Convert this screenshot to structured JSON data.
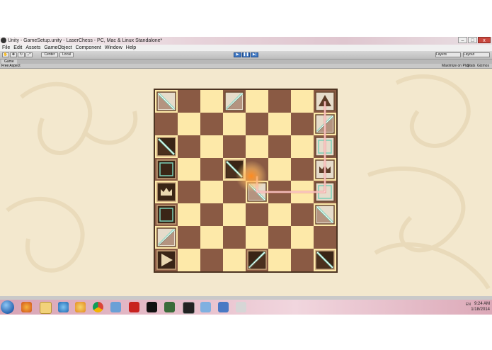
{
  "window": {
    "title": "Unity - GameSetup.unity - LaserChess - PC, Mac & Linux Standalone*",
    "controls": [
      "–",
      "□",
      "x"
    ]
  },
  "menu": [
    "File",
    "Edit",
    "Assets",
    "GameObject",
    "Component",
    "Window",
    "Help"
  ],
  "toolbar": {
    "pivot_label": "Center",
    "space_label": "Local",
    "layers_label": "Layers",
    "layout_label": "Layout"
  },
  "game_panel": {
    "tab_label": "Game",
    "aspect_label": "Free Aspect",
    "maximize_label": "Maximize on Play",
    "stats_label": "Stats",
    "gizmos_label": "Gizmos"
  },
  "board": {
    "size": 8,
    "colors": {
      "light": "#fde9a9",
      "dark": "#8a5a44",
      "piece_light": "#e6dccb",
      "piece_dark": "#3a2516",
      "laser": "#f08a8a",
      "laser_core": "#fff4f0",
      "mirror": "#7ad0b8"
    },
    "pieces": [
      {
        "row": 0,
        "col": 0,
        "kind": "mirror",
        "side": "light",
        "orient": "nw"
      },
      {
        "row": 0,
        "col": 3,
        "kind": "mirror",
        "side": "light",
        "orient": "ne"
      },
      {
        "row": 0,
        "col": 7,
        "kind": "laser",
        "side": "light",
        "orient": "up"
      },
      {
        "row": 1,
        "col": 7,
        "kind": "mirror",
        "side": "light",
        "orient": "ne"
      },
      {
        "row": 2,
        "col": 0,
        "kind": "mirror",
        "side": "dark",
        "orient": "nw"
      },
      {
        "row": 2,
        "col": 7,
        "kind": "block",
        "side": "light"
      },
      {
        "row": 3,
        "col": 0,
        "kind": "block",
        "side": "dark"
      },
      {
        "row": 3,
        "col": 3,
        "kind": "mirror",
        "side": "dark",
        "orient": "nw"
      },
      {
        "row": 3,
        "col": 7,
        "kind": "king",
        "side": "light"
      },
      {
        "row": 4,
        "col": 0,
        "kind": "king",
        "side": "dark"
      },
      {
        "row": 4,
        "col": 4,
        "kind": "mirror",
        "side": "light",
        "orient": "nw"
      },
      {
        "row": 4,
        "col": 7,
        "kind": "block",
        "side": "light"
      },
      {
        "row": 5,
        "col": 0,
        "kind": "block",
        "side": "dark"
      },
      {
        "row": 5,
        "col": 7,
        "kind": "mirror",
        "side": "light",
        "orient": "nw"
      },
      {
        "row": 6,
        "col": 0,
        "kind": "mirror",
        "side": "light",
        "orient": "ne"
      },
      {
        "row": 7,
        "col": 0,
        "kind": "laser",
        "side": "dark",
        "orient": "right"
      },
      {
        "row": 7,
        "col": 4,
        "kind": "mirror",
        "side": "dark",
        "orient": "ne"
      },
      {
        "row": 7,
        "col": 7,
        "kind": "mirror",
        "side": "dark",
        "orient": "nw"
      }
    ],
    "laser_path": [
      [
        0,
        7
      ],
      [
        4,
        7
      ],
      [
        4,
        4
      ],
      [
        3.3,
        4
      ]
    ],
    "impact": [
      3.3,
      4
    ]
  },
  "taskbar": {
    "icons": [
      "firefox-icon",
      "folder-icon",
      "ie-icon",
      "media-icon",
      "chrome-icon",
      "virtualbox-icon",
      "acrobat-icon",
      "terminal-icon",
      "gimp-icon",
      "unity-icon",
      "network-icon",
      "remote-icon",
      "paint-icon"
    ],
    "tray_text": "EN",
    "time": "9:24 AM",
    "date": "1/18/2014"
  }
}
